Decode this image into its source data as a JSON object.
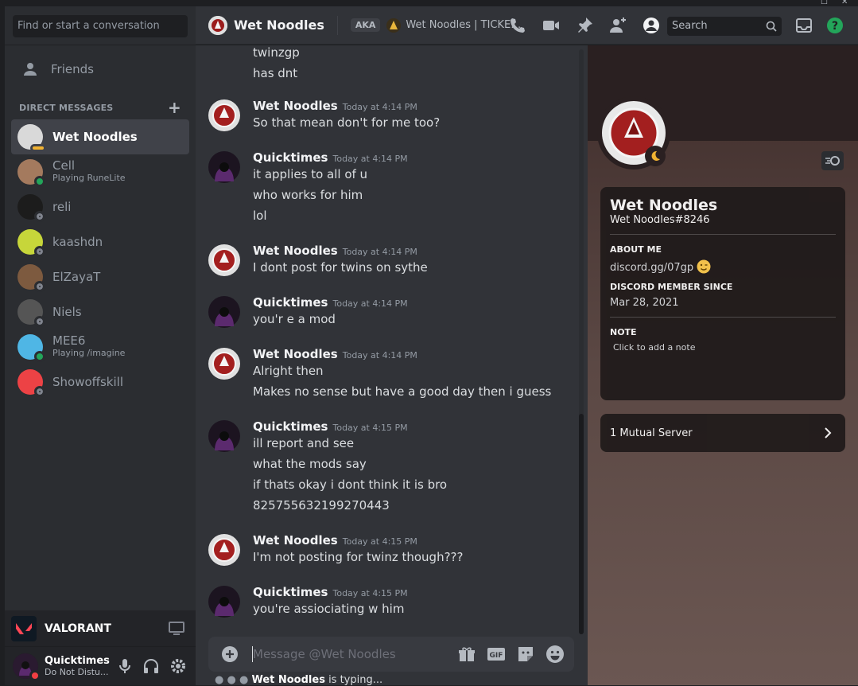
{
  "sidebar": {
    "search_placeholder": "Find or start a conversation",
    "friends_label": "Friends",
    "dm_header": "DIRECT MESSAGES",
    "dms": [
      {
        "name": "Wet Noodles",
        "sub": "",
        "status": "dnd",
        "color": "#d9d9d9",
        "active": true
      },
      {
        "name": "Cell",
        "sub": "Playing RuneLite",
        "status": "online",
        "color": "#a47a5e"
      },
      {
        "name": "reli",
        "sub": "",
        "status": "offline",
        "color": "#1c1c1c"
      },
      {
        "name": "kaashdn",
        "sub": "",
        "status": "offline",
        "color": "#c7d63a"
      },
      {
        "name": "ElZayaT",
        "sub": "",
        "status": "offline",
        "color": "#7d5a3f"
      },
      {
        "name": "Niels",
        "sub": "",
        "status": "offline",
        "color": "#555555"
      },
      {
        "name": "MEE6",
        "sub": "Playing /imagine",
        "status": "online",
        "color": "#4fb6e5"
      },
      {
        "name": "Showoffskill",
        "sub": "",
        "status": "offline",
        "color": "#ed4245"
      }
    ],
    "activity_game": "VALORANT",
    "user": {
      "name": "Quicktimes",
      "status": "Do Not Distu..."
    }
  },
  "header": {
    "name": "Wet Noodles",
    "aka": "AKA",
    "server": "Wet Noodles | TICKET...",
    "search_placeholder": "Search"
  },
  "chat": {
    "partial_lines": [
      "twinzgp",
      "has dnt"
    ],
    "messages": [
      {
        "author": "Wet Noodles",
        "time": "Today at 4:14 PM",
        "lines": [
          "So that mean don't for me too?"
        ]
      },
      {
        "author": "Quicktimes",
        "time": "Today at 4:14 PM",
        "lines": [
          "it applies to all of u",
          "who works for him",
          "lol"
        ]
      },
      {
        "author": "Wet Noodles",
        "time": "Today at 4:14 PM",
        "lines": [
          "I dont post for twins on sythe"
        ]
      },
      {
        "author": "Quicktimes",
        "time": "Today at 4:14 PM",
        "lines": [
          "you'r e a mod"
        ]
      },
      {
        "author": "Wet Noodles",
        "time": "Today at 4:14 PM",
        "lines": [
          "Alright then",
          "Makes no sense but have a good day then i guess"
        ]
      },
      {
        "author": "Quicktimes",
        "time": "Today at 4:15 PM",
        "lines": [
          "ill report and see",
          "what the mods say",
          "if thats okay i dont think it is bro",
          "825755632199270443"
        ]
      },
      {
        "author": "Wet Noodles",
        "time": "Today at 4:15 PM",
        "lines": [
          "I'm not posting for twinz though???"
        ]
      },
      {
        "author": "Quicktimes",
        "time": "Today at 4:15 PM",
        "lines": [
          "you're assiociating w him"
        ]
      }
    ],
    "composer_placeholder": "Message @Wet Noodles",
    "typing_user": "Wet Noodles",
    "typing_text": " is typing..."
  },
  "profile": {
    "name": "Wet Noodles",
    "tag": "Wet Noodles#8246",
    "about_label": "ABOUT ME",
    "about_value": "discord.gg/07gp",
    "member_label": "DISCORD MEMBER SINCE",
    "member_value": "Mar 28, 2021",
    "note_label": "NOTE",
    "note_placeholder": "Click to add a note",
    "mutual": "1 Mutual Server"
  }
}
